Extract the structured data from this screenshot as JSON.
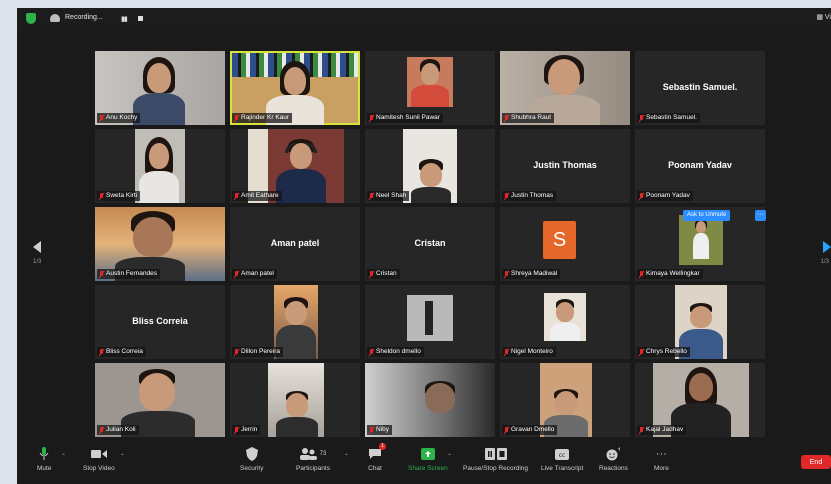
{
  "topbar": {
    "recording_label": "Recording...",
    "view_label": "Vi"
  },
  "pagination": {
    "left": "1/3",
    "right": "1/3"
  },
  "popup": {
    "ask_to_unmute": "Ask to Unmute",
    "more": "···"
  },
  "participants": [
    {
      "name": "Anu Kochy"
    },
    {
      "name": "Rajinder Kr Kaur"
    },
    {
      "name": "Namitesh Sunil Pawar"
    },
    {
      "name": "Shubhra Raut"
    },
    {
      "name": "Sebastin Samuel.",
      "big_label": "Sebastin Samuel."
    },
    {
      "name": "Sweta Kirti"
    },
    {
      "name": "Amit Eathare"
    },
    {
      "name": "Neel Shah"
    },
    {
      "name": "Justin Thomas",
      "big_label": "Justin Thomas"
    },
    {
      "name": "Poonam Yadav",
      "big_label": "Poonam Yadav"
    },
    {
      "name": "Austin Fernandes"
    },
    {
      "name": "Aman patel",
      "big_label": "Aman patel"
    },
    {
      "name": "Cristan",
      "big_label": "Cristan"
    },
    {
      "name": "Shreya Madiwal",
      "avatar_letter": "S"
    },
    {
      "name": "Kimaya Wellingkar"
    },
    {
      "name": "Bliss Correia",
      "big_label": "Bliss Correia"
    },
    {
      "name": "Dillon Pereira"
    },
    {
      "name": "Sheldon dmello"
    },
    {
      "name": "Nigel Monteiro"
    },
    {
      "name": "Chrys Rebello"
    },
    {
      "name": "Julian Koli"
    },
    {
      "name": "Jerrin"
    },
    {
      "name": "Niby"
    },
    {
      "name": "Gravan Dmello"
    },
    {
      "name": "Kajal Jadhav"
    }
  ],
  "toolbar": {
    "mute": "Mute",
    "stop_video": "Stop Video",
    "security": "Security",
    "participants": "Participants",
    "participants_count": "73",
    "chat": "Chat",
    "chat_badge": "1",
    "share_screen": "Share Screen",
    "pause_recording": "Pause/Stop Recording",
    "live_transcript": "Live Transcript",
    "reactions": "Reactions",
    "more": "More",
    "end": "End"
  },
  "colors": {
    "active_speaker": "#d7e33a",
    "share_green": "#2db34a",
    "end_red": "#e02828",
    "accent_blue": "#2d8cff",
    "avatar_orange": "#e5672a"
  }
}
